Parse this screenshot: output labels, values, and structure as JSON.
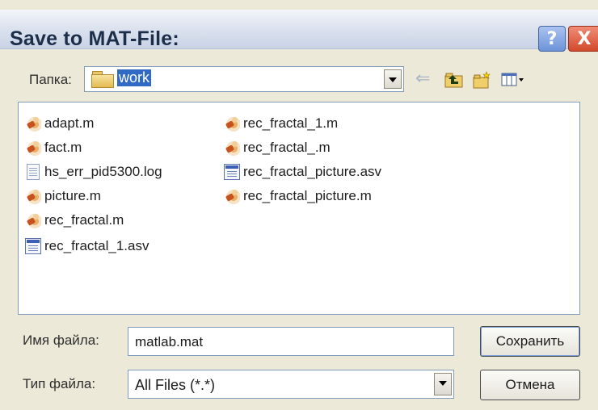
{
  "window": {
    "title": "Save to MAT-File:",
    "help_glyph": "?",
    "close_glyph": "X"
  },
  "location": {
    "label": "Папка:",
    "folder": "work"
  },
  "toolbar": {
    "back_glyph": "⇐"
  },
  "files": [
    {
      "name": "adapt.m",
      "icon": "matlab-m-icon"
    },
    {
      "name": "fact.m",
      "icon": "matlab-m-icon"
    },
    {
      "name": "hs_err_pid5300.log",
      "icon": "log-file-icon"
    },
    {
      "name": "picture.m",
      "icon": "matlab-m-icon"
    },
    {
      "name": "rec_fractal.m",
      "icon": "matlab-m-icon"
    },
    {
      "name": "rec_fractal_1.asv",
      "icon": "asv-file-icon"
    },
    {
      "name": "rec_fractal_1.m",
      "icon": "matlab-m-icon"
    },
    {
      "name": "rec_fractal_.m",
      "icon": "matlab-m-icon"
    },
    {
      "name": "rec_fractal_picture.asv",
      "icon": "asv-file-icon"
    },
    {
      "name": "rec_fractal_picture.m",
      "icon": "matlab-m-icon"
    }
  ],
  "filename": {
    "label": "Имя файла:",
    "value": "matlab.mat"
  },
  "filetype": {
    "label": "Тип файла:",
    "value": "All Files (*.*)"
  },
  "buttons": {
    "save": "Сохранить",
    "cancel": "Отмена"
  },
  "colors": {
    "dialog_bg": "#ece9d8",
    "selection": "#316ac5",
    "close_button": "#d24a2c"
  }
}
